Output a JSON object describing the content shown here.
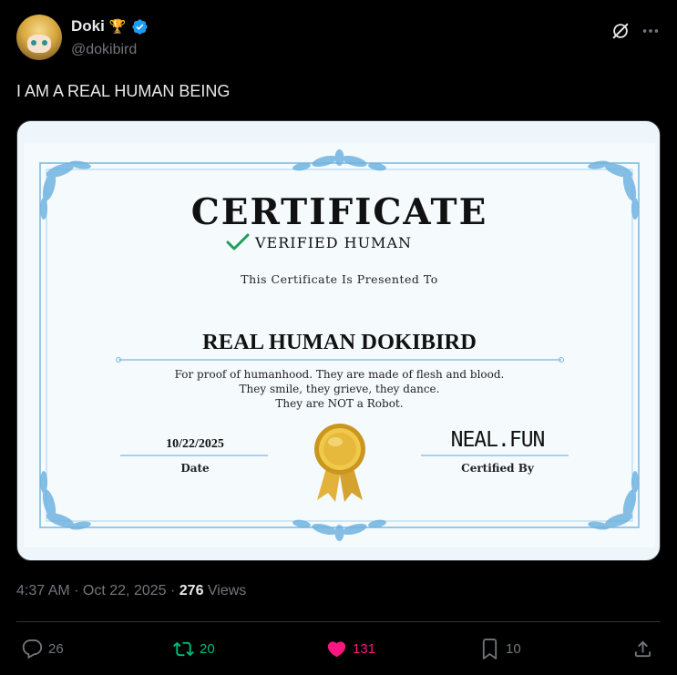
{
  "author": {
    "display_name": "Doki",
    "handle": "@dokibird",
    "name_emoji": "🏆",
    "verified_icon": "verified-badge-icon",
    "accent": "#1d9bf0"
  },
  "tweet": {
    "text": "I AM A REAL HUMAN BEING",
    "time": "4:37 AM",
    "sep1": " · ",
    "date": "Oct 22, 2025",
    "sep2": " · ",
    "views_count": "276",
    "views_label": " Views"
  },
  "certificate": {
    "title": "CERTIFICATE",
    "subtitle": "VERIFIED HUMAN",
    "presented_to": "This Certificate Is Presented To",
    "recipient": "REAL HUMAN DOKIBIRD",
    "desc_line1": "For proof of humanhood. They are made of flesh and blood.",
    "desc_line2": "They smile, they grieve, they dance.",
    "desc_line3": "They are NOT a Robot.",
    "date_value": "10/22/2025",
    "date_label": "Date",
    "certified_by_value": "NEAL.FUN",
    "certified_by_label": "Certified By"
  },
  "actions": {
    "replies": "26",
    "reposts": "20",
    "likes": "131",
    "bookmarks": "10",
    "repost_color": "#00ba7c",
    "like_color": "#f91880"
  }
}
